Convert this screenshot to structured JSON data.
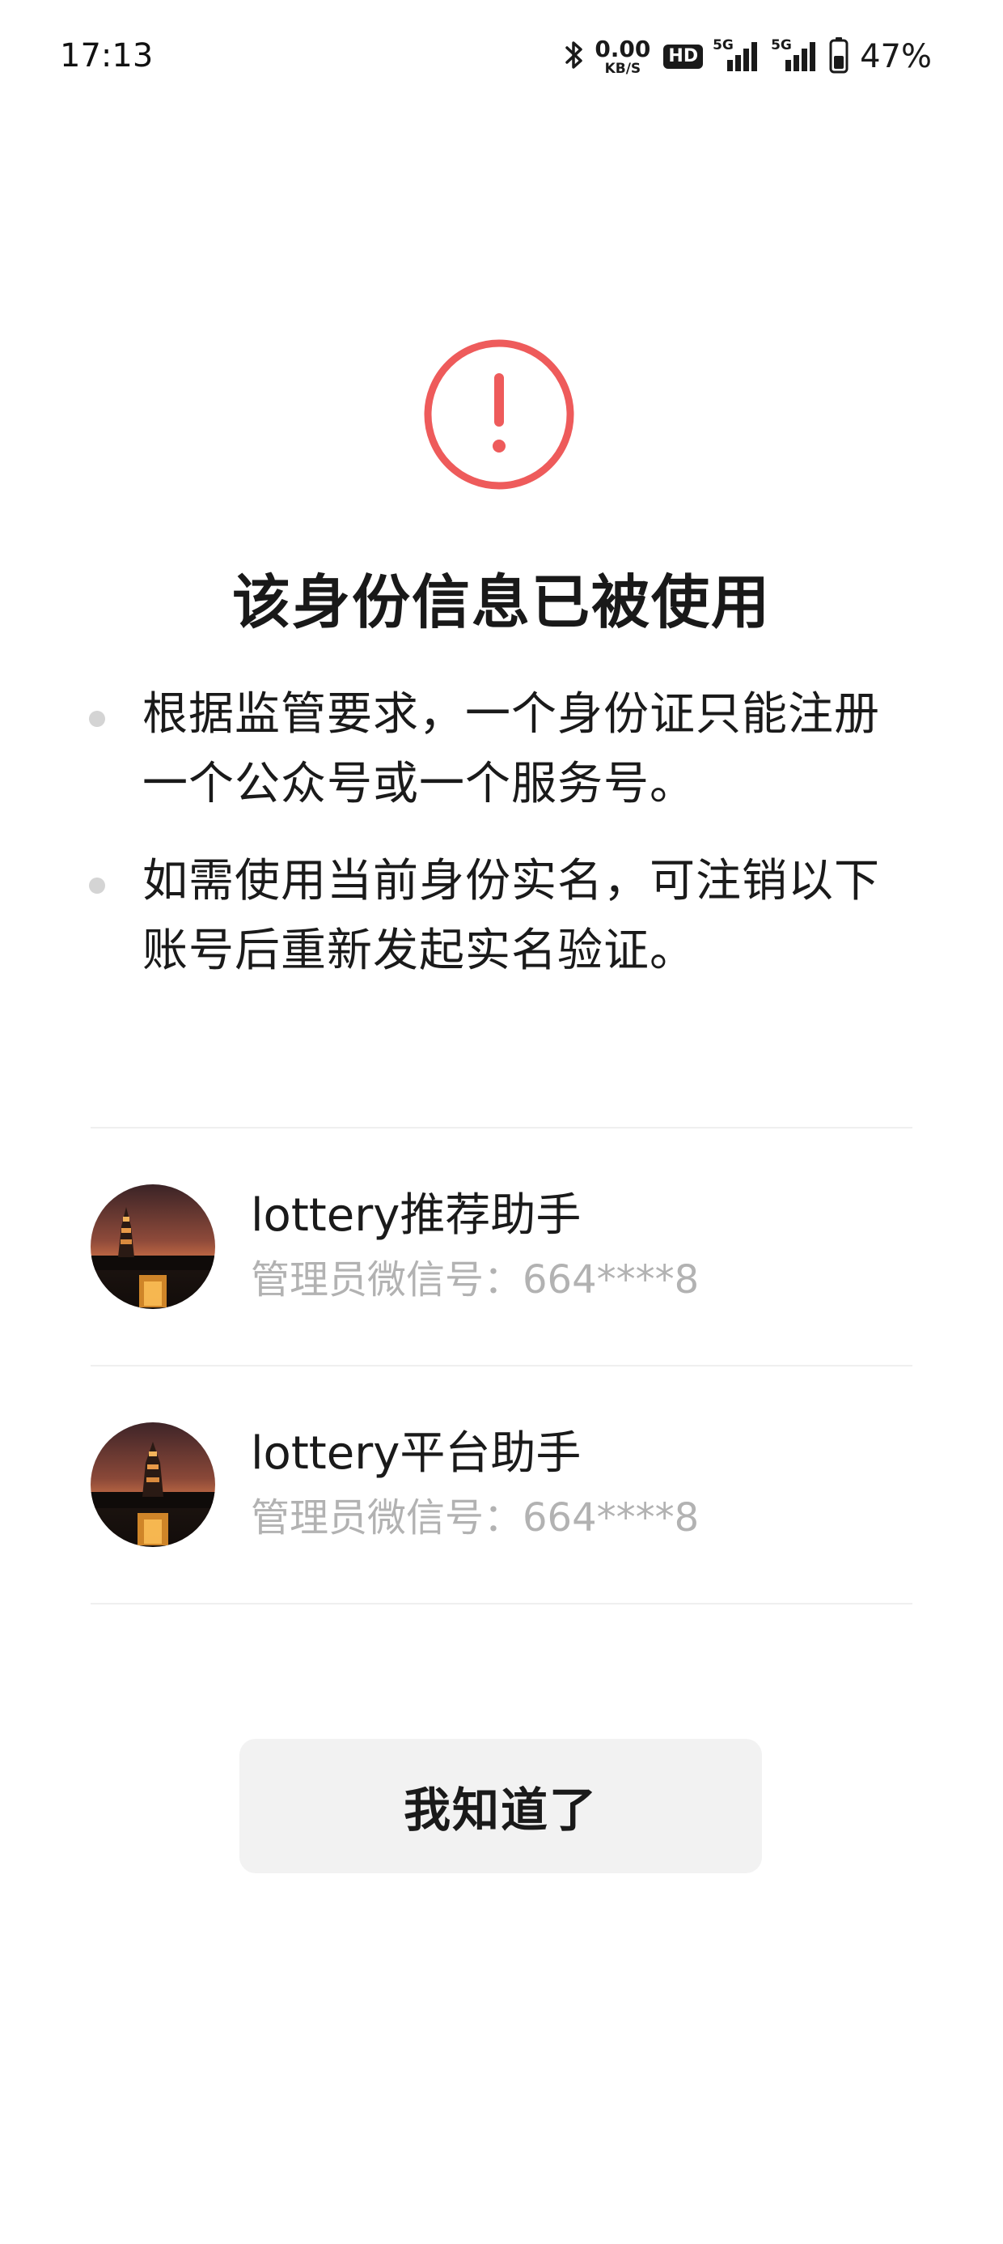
{
  "status_bar": {
    "time": "17:13",
    "net_speed_value": "0.00",
    "net_speed_unit": "KB/S",
    "hd_label": "HD",
    "signal1_label": "5G",
    "signal2_label": "5G",
    "battery_percent": "47%",
    "icons": [
      "bluetooth-icon",
      "hd-icon",
      "signal-icon",
      "signal-icon",
      "battery-icon"
    ]
  },
  "dialog": {
    "icon": "exclamation-circle-icon",
    "accent_color": "#ee5b5b",
    "title": "该身份信息已被使用",
    "bullets": [
      "根据监管要求，一个身份证只能注册一个公众号或一个服务号。",
      "如需使用当前身份实名，可注销以下账号后重新发起实名验证。"
    ]
  },
  "accounts": [
    {
      "name": "lottery推荐助手",
      "admin_label": "管理员微信号：",
      "admin_id": "664****8",
      "avatar": "pagoda-sunset-avatar"
    },
    {
      "name": "lottery平台助手",
      "admin_label": "管理员微信号：",
      "admin_id": "664****8",
      "avatar": "pagoda-sunset-avatar"
    }
  ],
  "confirm_button": {
    "label": "我知道了"
  }
}
